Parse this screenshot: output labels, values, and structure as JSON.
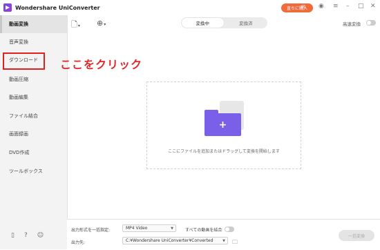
{
  "app": {
    "title": "Wondershare UniConverter",
    "purchase_label": "直ちに購入"
  },
  "sidebar": {
    "items": [
      {
        "label": "動画変換",
        "active": true
      },
      {
        "label": "音声変換"
      },
      {
        "label": "ダウンロード"
      },
      {
        "label": "動画圧縮"
      },
      {
        "label": "動画編集"
      },
      {
        "label": "ファイル結合"
      },
      {
        "label": "画面録画"
      },
      {
        "label": "DVD作成"
      },
      {
        "label": "ツールボックス"
      }
    ]
  },
  "annotation": {
    "text": "ここをクリック"
  },
  "toolbar": {
    "tabs": [
      {
        "label": "変換中",
        "selected": true
      },
      {
        "label": "変換済"
      }
    ],
    "fast_convert_label": "高速変換"
  },
  "dropzone": {
    "text": "ここにファイルを追加またはドラッグして変換を開始します"
  },
  "bottom": {
    "format_label": "出力形式を一括指定:",
    "format_value": "MP4 Video",
    "merge_label": "すべての動画を結合",
    "output_label": "出力先:",
    "output_value": "C:¥Wondershare UniConverter¥Converted",
    "convert_all_label": "一括変換"
  },
  "colors": {
    "accent": "#7a5fe8",
    "purchase": "#f06a3a",
    "annotation": "#e02020"
  }
}
